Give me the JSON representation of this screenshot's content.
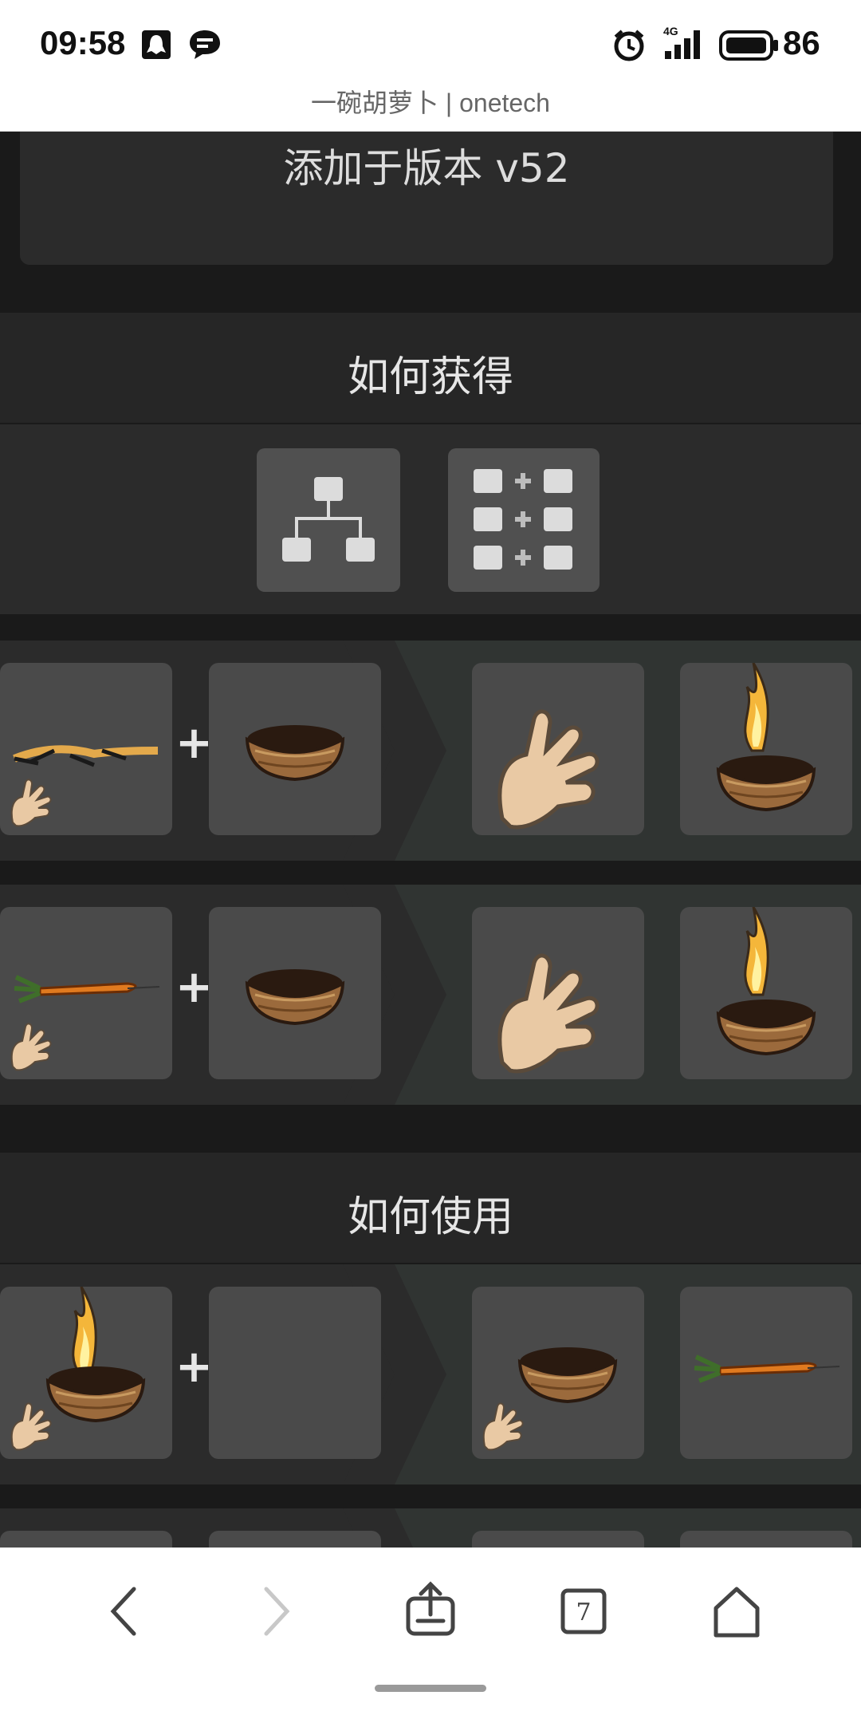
{
  "status_bar": {
    "time": "09:58",
    "network": "4G",
    "battery": "86",
    "icons": [
      "qq-icon",
      "message-icon",
      "alarm-icon",
      "signal-icon",
      "battery-icon"
    ]
  },
  "page": {
    "title": "一碗胡萝卜 | onetech"
  },
  "version": {
    "text": "添加于版本 v52"
  },
  "sections": {
    "how_to_get": {
      "title": "如何获得"
    },
    "how_to_use": {
      "title": "如何使用"
    }
  },
  "mode_buttons": [
    {
      "icon": "tree-view-icon"
    },
    {
      "icon": "recipe-grid-icon"
    }
  ],
  "recipes": [
    {
      "actor": "roasted-carrot-in-hand",
      "target": "bowl",
      "result_actor": "empty-hand",
      "result_target": "burning-bowl"
    },
    {
      "actor": "carrot-in-hand",
      "target": "bowl",
      "result_actor": "empty-hand",
      "result_target": "burning-bowl"
    },
    {
      "actor": "burning-bowl-in-hand",
      "target": "empty",
      "result_actor": "bowl-in-hand",
      "result_target": "carrot"
    }
  ],
  "symbols": {
    "plus": "+"
  },
  "bottom_nav": {
    "tab_count": "7",
    "icons": [
      "back-icon",
      "forward-icon",
      "share-icon",
      "tabs-icon",
      "home-icon"
    ]
  },
  "colors": {
    "background": "#1a1a1a",
    "panel": "#2b2b2b",
    "slot": "#4a4a4a",
    "result_panel": "#303432",
    "carrot": "#e07a1f",
    "bowl": "#8a5a2e"
  }
}
